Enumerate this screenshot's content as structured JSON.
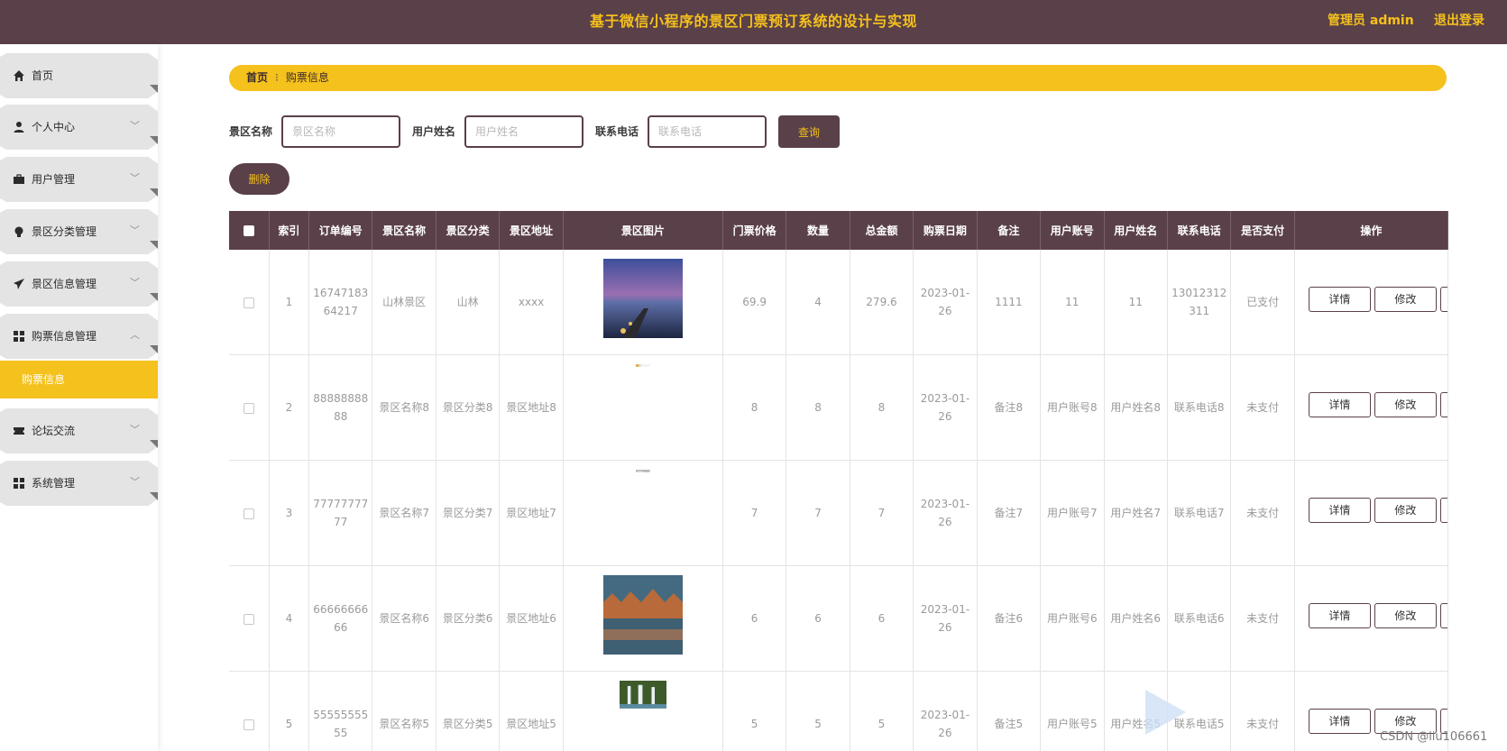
{
  "header": {
    "title": "基于微信小程序的景区门票预订系统的设计与实现",
    "admin_label": "管理员 admin",
    "logout_label": "退出登录"
  },
  "sidebar": {
    "items": [
      {
        "label": "首页",
        "icon": "home-icon",
        "has_arrow": false
      },
      {
        "label": "个人中心",
        "icon": "user-icon",
        "has_arrow": true
      },
      {
        "label": "用户管理",
        "icon": "briefcase-icon",
        "has_arrow": true
      },
      {
        "label": "景区分类管理",
        "icon": "bulb-icon",
        "has_arrow": true
      },
      {
        "label": "景区信息管理",
        "icon": "send-icon",
        "has_arrow": true
      },
      {
        "label": "购票信息管理",
        "icon": "grid-icon",
        "has_arrow": true,
        "expanded": true
      },
      {
        "label": "论坛交流",
        "icon": "ticket-icon",
        "has_arrow": true
      },
      {
        "label": "系统管理",
        "icon": "grid-icon",
        "has_arrow": true
      }
    ],
    "active_sub": "购票信息"
  },
  "breadcrumb": {
    "home": "首页",
    "current": "购票信息"
  },
  "search": {
    "scenic_name_label": "景区名称",
    "scenic_name_placeholder": "景区名称",
    "user_name_label": "用户姓名",
    "user_name_placeholder": "用户姓名",
    "phone_label": "联系电话",
    "phone_placeholder": "联系电话",
    "query_button": "查询"
  },
  "delete_button": "删除",
  "table": {
    "headers": [
      "索引",
      "订单编号",
      "景区名称",
      "景区分类",
      "景区地址",
      "景区图片",
      "门票价格",
      "数量",
      "总金额",
      "购票日期",
      "备注",
      "用户账号",
      "用户姓名",
      "联系电话",
      "是否支付",
      "操作"
    ],
    "rows": [
      {
        "index": "1",
        "order_no": "1674718364217",
        "scenic_name": "山林景区",
        "category": "山林",
        "address": "xxxx",
        "image": "lake-dusk",
        "price": "69.9",
        "qty": "4",
        "total": "279.6",
        "date": "2023-01-26",
        "note": "1111",
        "account": "11",
        "user_name": "11",
        "phone": "13012312311",
        "paid": "已支付"
      },
      {
        "index": "2",
        "order_no": "8888888888",
        "scenic_name": "景区名称8",
        "category": "景区分类8",
        "address": "景区地址8",
        "image": "strip-gold",
        "price": "8",
        "qty": "8",
        "total": "8",
        "date": "2023-01-26",
        "note": "备注8",
        "account": "用户账号8",
        "user_name": "用户姓名8",
        "phone": "联系电话8",
        "paid": "未支付"
      },
      {
        "index": "3",
        "order_no": "7777777777",
        "scenic_name": "景区名称7",
        "category": "景区分类7",
        "address": "景区地址7",
        "image": "strip-gray",
        "price": "7",
        "qty": "7",
        "total": "7",
        "date": "2023-01-26",
        "note": "备注7",
        "account": "用户账号7",
        "user_name": "用户姓名7",
        "phone": "联系电话7",
        "paid": "未支付"
      },
      {
        "index": "4",
        "order_no": "6666666666",
        "scenic_name": "景区名称6",
        "category": "景区分类6",
        "address": "景区地址6",
        "image": "autumn-lake",
        "price": "6",
        "qty": "6",
        "total": "6",
        "date": "2023-01-26",
        "note": "备注6",
        "account": "用户账号6",
        "user_name": "用户姓名6",
        "phone": "联系电话6",
        "paid": "未支付"
      },
      {
        "index": "5",
        "order_no": "5555555555",
        "scenic_name": "景区名称5",
        "category": "景区分类5",
        "address": "景区地址5",
        "image": "waterfall",
        "price": "5",
        "qty": "5",
        "total": "5",
        "date": "2023-01-26",
        "note": "备注5",
        "account": "用户账号5",
        "user_name": "用户姓名5",
        "phone": "联系电话5",
        "paid": "未支付"
      }
    ],
    "detail_button": "详情",
    "edit_button": "修改"
  },
  "watermark": "CSDN @liu106661",
  "colors": {
    "header_bg": "#5a4048",
    "accent": "#f5c11c",
    "menu_bg": "#e4e4e4"
  }
}
